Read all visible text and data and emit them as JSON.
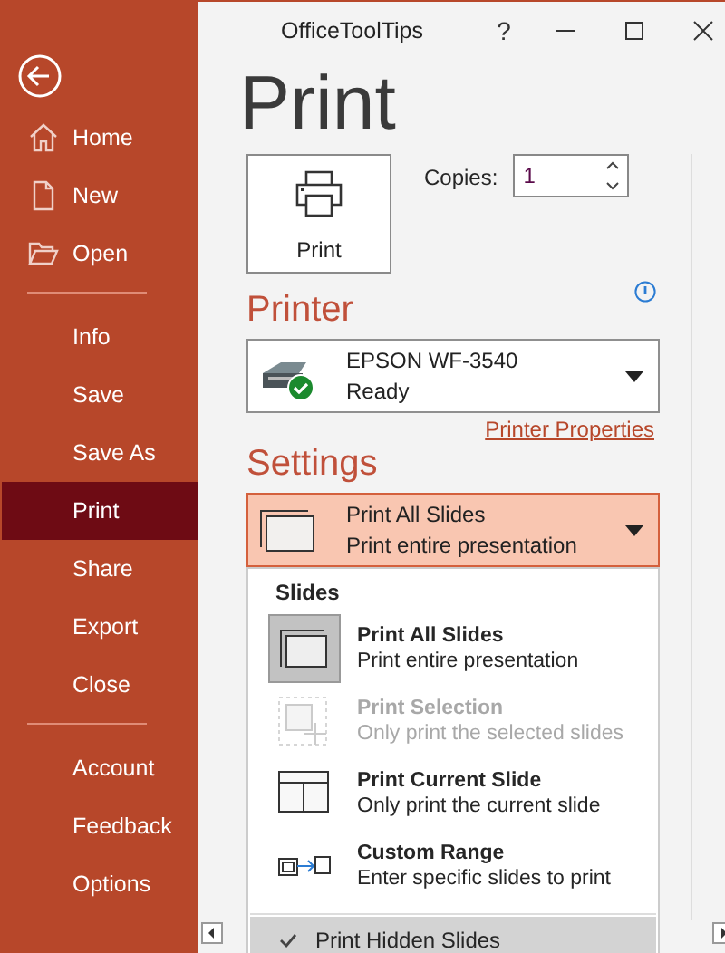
{
  "window": {
    "title": "OfficeToolTips",
    "controls": [
      "?"
    ]
  },
  "sidebar": {
    "groups": [
      [
        {
          "label": "Home",
          "selected": false
        },
        {
          "label": "New",
          "selected": false
        },
        {
          "label": "Open",
          "selected": false
        }
      ],
      [
        {
          "label": "Info",
          "selected": false
        },
        {
          "label": "Save",
          "selected": false
        },
        {
          "label": "Save As",
          "selected": false
        },
        {
          "label": "Print",
          "selected": true
        },
        {
          "label": "Share",
          "selected": false
        },
        {
          "label": "Export",
          "selected": false
        },
        {
          "label": "Close",
          "selected": false
        }
      ],
      [
        {
          "label": "Account",
          "selected": false
        },
        {
          "label": "Feedback",
          "selected": false
        },
        {
          "label": "Options",
          "selected": false
        }
      ]
    ]
  },
  "heading": "Print",
  "print_button": "Print",
  "copies": {
    "label": "Copies:",
    "value": "1"
  },
  "printer": {
    "heading": "Printer",
    "name": "EPSON WF-3540",
    "status": "Ready",
    "properties_link": "Printer Properties"
  },
  "settings": {
    "heading": "Settings",
    "selection": {
      "title": "Print All Slides",
      "subtitle": "Print entire presentation",
      "expanded": true
    }
  },
  "menu": {
    "section": "Slides",
    "items": [
      {
        "title": "Print All Slides",
        "subtitle": "Print entire presentation",
        "selected": true,
        "disabled": false
      },
      {
        "title": "Print Selection",
        "subtitle": "Only print the selected slides",
        "selected": false,
        "disabled": true
      },
      {
        "title": "Print Current Slide",
        "subtitle": "Only print the current slide",
        "selected": false,
        "disabled": false
      },
      {
        "title": "Custom Range",
        "subtitle": "Enter specific slides to print",
        "selected": false,
        "disabled": false
      }
    ],
    "toggle": {
      "label": "Print Hidden Slides",
      "checked": true
    }
  }
}
